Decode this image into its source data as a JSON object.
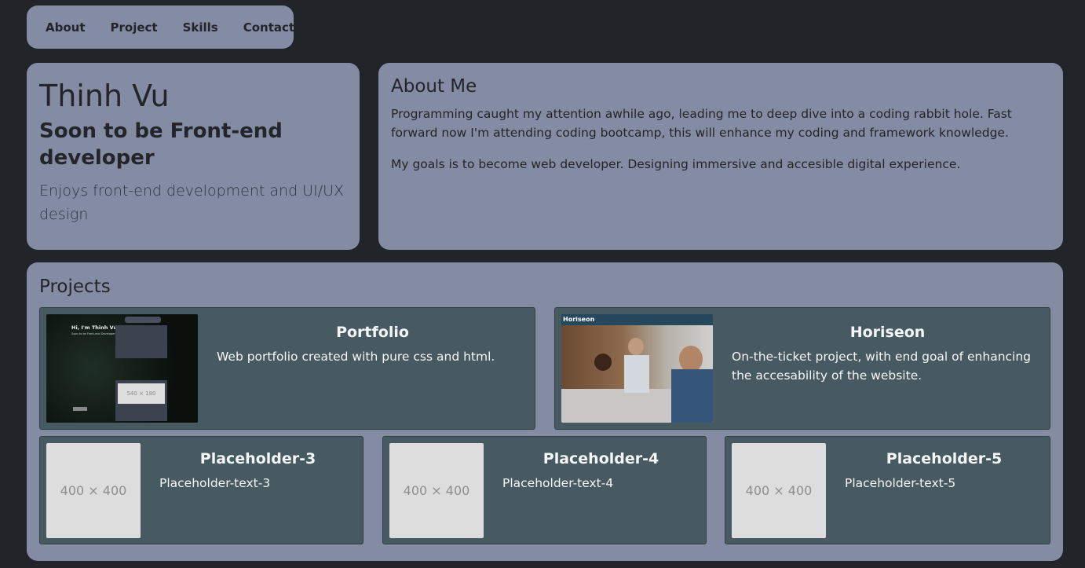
{
  "nav": {
    "items": [
      "About",
      "Project",
      "Skills",
      "Contact"
    ]
  },
  "intro": {
    "name": "Thinh Vu",
    "subtitle": "Soon to be Front-end developer",
    "tagline": "Enjoys front-end development and UI/UX design"
  },
  "about": {
    "title": "About Me",
    "p1": "Programming caught my attention awhile ago, leading me to deep dive into a coding rabbit hole. Fast forward now I'm attending coding bootcamp, this will enhance my coding and framework knowledge.",
    "p2": "My goals is to become web developer. Designing immersive and accesible digital experience."
  },
  "projects": {
    "title": "Projects",
    "items": [
      {
        "title": "Portfolio",
        "text": "Web portfolio created with pure css and html.",
        "thumb": {
          "heading": "Hi, I'm Thinh Vu",
          "sub": "Soon to be Front-end Developer",
          "placeholder": "540 × 180"
        }
      },
      {
        "title": "Horiseon",
        "text": "On-the-ticket project, with end goal of enhancing the accesability of the website.",
        "thumb": {
          "brand": "Horiseon"
        }
      },
      {
        "title": "Placeholder-3",
        "text": "Placeholder-text-3",
        "thumb": {
          "placeholder": "400 × 400"
        }
      },
      {
        "title": "Placeholder-4",
        "text": "Placeholder-text-4",
        "thumb": {
          "placeholder": "400 × 400"
        }
      },
      {
        "title": "Placeholder-5",
        "text": "Placeholder-text-5",
        "thumb": {
          "placeholder": "400 × 400"
        }
      }
    ]
  },
  "colors": {
    "background": "#212428",
    "card": "#838ca3",
    "project_card": "#475a61"
  }
}
